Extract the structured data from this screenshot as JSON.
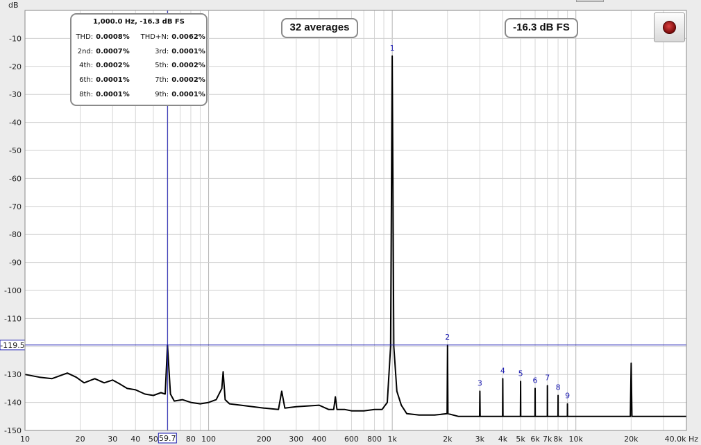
{
  "chart_data": {
    "type": "line",
    "ylabel": "dB",
    "xunit": "Hz",
    "xscale": "log",
    "xlim": [
      10,
      40000
    ],
    "ylim": [
      -150,
      0
    ],
    "yticks": [
      0,
      -10,
      -20,
      -30,
      -40,
      -50,
      -60,
      -70,
      -80,
      -90,
      -100,
      -110,
      -120,
      -130,
      -140,
      -150
    ],
    "ytick_labels": [
      "",
      "-10",
      "-20",
      "-30",
      "-40",
      "-50",
      "-60",
      "-70",
      "-80",
      "-90",
      "-100",
      "-110",
      "",
      "-130",
      "-140",
      "-150"
    ],
    "xtick_values": [
      10,
      20,
      30,
      40,
      50,
      80,
      100,
      200,
      300,
      400,
      600,
      800,
      1000,
      2000,
      3000,
      4000,
      5000,
      6000,
      7000,
      8000,
      10000,
      20000,
      40000
    ],
    "xtick_labels": [
      "10",
      "20",
      "30",
      "40",
      "50",
      "80",
      "100",
      "200",
      "300",
      "400",
      "600",
      "800",
      "1k",
      "2k",
      "3k",
      "4k",
      "5k",
      "6k",
      "7k",
      "8k",
      "10k",
      "20k",
      "40.0k Hz"
    ],
    "grid": true,
    "series": [
      {
        "color": "#000000",
        "x": [
          10,
          12,
          14,
          17,
          19,
          21,
          24,
          27,
          30,
          33,
          36,
          40,
          45,
          50,
          55,
          58,
          59.7,
          62,
          65,
          72,
          80,
          90,
          100,
          110,
          118,
          120,
          123,
          130,
          150,
          200,
          240,
          250,
          260,
          300,
          400,
          450,
          480,
          490,
          500,
          550,
          600,
          700,
          800,
          880,
          940,
          980,
          1000,
          1020,
          1060,
          1120,
          1200,
          1400,
          1700,
          1990,
          2000,
          2010,
          2300,
          2990,
          3000,
          3010,
          3600,
          3990,
          4000,
          4010,
          4500,
          4990,
          5000,
          5010,
          5500,
          5990,
          6000,
          6010,
          6500,
          6990,
          7000,
          7010,
          7500,
          7990,
          8000,
          8010,
          8500,
          8990,
          9000,
          9010,
          10000,
          12000,
          15000,
          19800,
          20000,
          20200,
          25000,
          30000,
          35000,
          40000
        ],
        "y": [
          -130,
          -131,
          -131.5,
          -129.5,
          -131,
          -133,
          -131.5,
          -133,
          -132,
          -133.5,
          -135,
          -135.5,
          -137,
          -137.5,
          -136.5,
          -137,
          -119.5,
          -137,
          -139.5,
          -139,
          -140,
          -140.5,
          -140,
          -139,
          -135,
          -129,
          -139,
          -140.5,
          -141,
          -142,
          -142.5,
          -136,
          -142,
          -141.5,
          -141,
          -142.5,
          -142.5,
          -138,
          -142.5,
          -142.5,
          -143,
          -143,
          -142.5,
          -142.5,
          -140,
          -120,
          -16.3,
          -120,
          -136,
          -141,
          -144,
          -144.5,
          -144.5,
          -144,
          -119.5,
          -144,
          -145,
          -145,
          -136,
          -145,
          -145,
          -145,
          -131.5,
          -145,
          -145,
          -145,
          -132.5,
          -145,
          -145,
          -145,
          -135,
          -145,
          -145,
          -145,
          -134,
          -145,
          -145,
          -145,
          -137.5,
          -145,
          -145,
          -145,
          -140.5,
          -145,
          -145,
          -145,
          -145,
          -145,
          -126,
          -145,
          -145,
          -145,
          -145,
          -145
        ]
      }
    ],
    "harmonics": [
      {
        "label": "1",
        "freq": 1000,
        "db": -16.3
      },
      {
        "label": "2",
        "freq": 2000,
        "db": -119.5
      },
      {
        "label": "3",
        "freq": 3000,
        "db": -136
      },
      {
        "label": "4",
        "freq": 4000,
        "db": -131.5
      },
      {
        "label": "5",
        "freq": 5000,
        "db": -132.5
      },
      {
        "label": "6",
        "freq": 6000,
        "db": -135
      },
      {
        "label": "7",
        "freq": 7000,
        "db": -134
      },
      {
        "label": "8",
        "freq": 8000,
        "db": -137.5
      },
      {
        "label": "9",
        "freq": 9000,
        "db": -140.5
      }
    ],
    "cursor": {
      "x": 59.7,
      "x_label": "59.7",
      "y": -119.5,
      "y_label": "-119.5",
      "color": "#1a1ab0"
    }
  },
  "distortion_panel": {
    "header": "1,000.0 Hz, -16.3 dB FS",
    "rows": [
      {
        "label_a": "THD:",
        "value_a": "0.0008%",
        "label_b": "THD+N:",
        "value_b": "0.0062%"
      },
      {
        "label_a": "2nd:",
        "value_a": "0.0007%",
        "label_b": "3rd:",
        "value_b": "0.0001%"
      },
      {
        "label_a": "4th:",
        "value_a": "0.0002%",
        "label_b": "5th:",
        "value_b": "0.0002%"
      },
      {
        "label_a": "6th:",
        "value_a": "0.0001%",
        "label_b": "7th:",
        "value_b": "0.0002%"
      },
      {
        "label_a": "8th:",
        "value_a": "0.0001%",
        "label_b": "9th:",
        "value_b": "0.0001%"
      }
    ]
  },
  "averages_label": "32 averages",
  "level_label": "-16.3 dB FS",
  "record_button_icon": "record-icon"
}
